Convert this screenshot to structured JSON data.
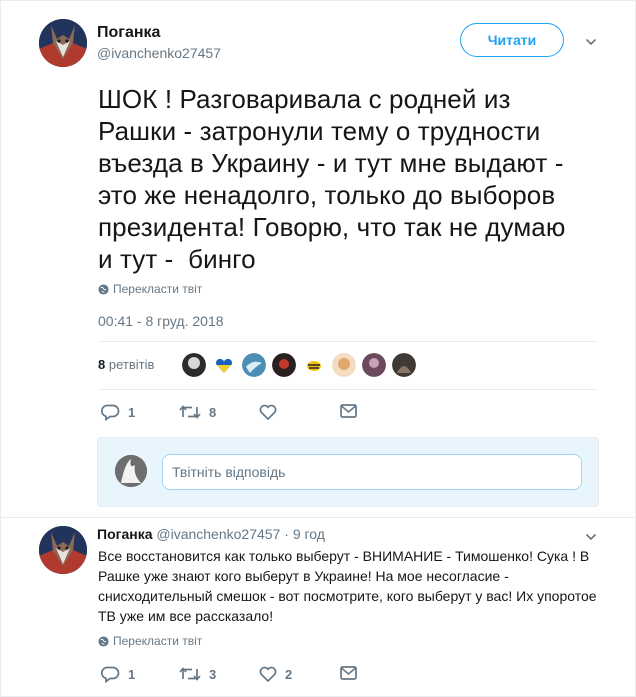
{
  "tweet": {
    "display_name": "Поганка",
    "handle": "@ivanchenko27457",
    "follow_label": "Читати",
    "text": "ШОК ! Разговаривала с родней из\nРашки - затронули тему о трудности\nвъезда в Украину - и тут мне выдают -\nэто же ненадолго, только до выборов\nпрезидента! Говорю, что так не думаю\nи тут -  бинго",
    "translate_label": "Перекласти твіт",
    "timestamp": "00:41 - 8 груд. 2018",
    "retweets_count": "8",
    "retweets_label": "ретвітів",
    "actions": {
      "reply_count": "1",
      "retweet_count": "8",
      "like_count": "",
      "mail_count": ""
    }
  },
  "reply_composer": {
    "placeholder": "Твітніть відповідь"
  },
  "reply": {
    "display_name": "Поганка",
    "handle": "@ivanchenko27457",
    "separator": "·",
    "time": "9 год",
    "text": "Все восстановится  как только выберут - ВНИМАНИЕ - Тимошенко! Сука ! В Рашке  уже знают кого выберут в Украине! На мое несогласие - снисходительный смешок - вот посмотрите, кого выберут у вас! Их упоротое ТВ уже им все рассказало!",
    "translate_label": "Перекласти твіт",
    "actions": {
      "reply_count": "1",
      "retweet_count": "3",
      "like_count": "2",
      "mail_count": ""
    }
  },
  "colors": {
    "accent": "#1da1f2",
    "muted": "#657786",
    "reply_bg": "#e8f5fd",
    "border": "#e6ecf0"
  },
  "icons": [
    "chevron-down-icon",
    "globe-icon",
    "reply-icon",
    "retweet-icon",
    "like-icon",
    "mail-icon"
  ]
}
